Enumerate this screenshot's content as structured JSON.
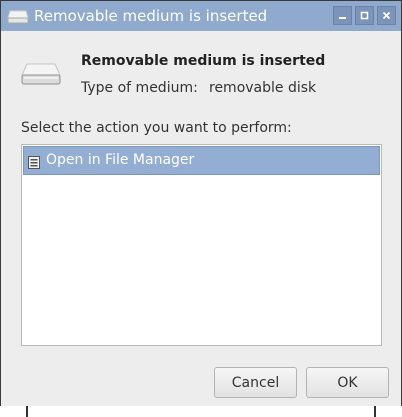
{
  "window": {
    "title": "Removable medium is inserted",
    "controls": {
      "minimize": "minimize",
      "maximize": "maximize",
      "close": "close"
    }
  },
  "dialog": {
    "heading": "Removable medium is inserted",
    "type_label": "Type of medium:",
    "type_value": "removable disk",
    "prompt": "Select the action you want to perform:",
    "actions": [
      {
        "label": "Open in File Manager",
        "icon": "file-manager-icon",
        "selected": true
      }
    ]
  },
  "buttons": {
    "cancel": "Cancel",
    "ok": "OK"
  },
  "colors": {
    "titlebar": "#90aacd",
    "selection": "#94aed3",
    "window_bg": "#ededed"
  }
}
